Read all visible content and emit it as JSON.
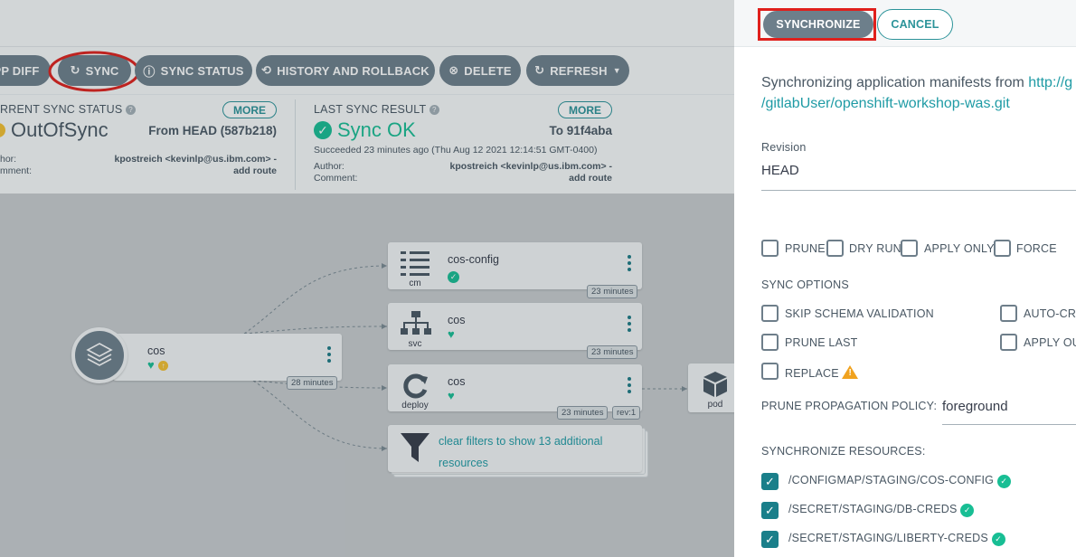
{
  "toolbar": {
    "app_diff": "PP DIFF",
    "sync": "SYNC",
    "sync_status": "SYNC STATUS",
    "history": "HISTORY AND ROLLBACK",
    "delete": "DELETE",
    "refresh": "REFRESH"
  },
  "current_sync": {
    "label": "RRENT SYNC STATUS",
    "more": "MORE",
    "status": "OutOfSync",
    "from": "From HEAD (587b218)",
    "author_label": "hor:",
    "author": "kpostreich <kevinlp@us.ibm.com> -",
    "comment_label": "mment:",
    "comment": "add route"
  },
  "last_sync": {
    "label": "LAST SYNC RESULT",
    "more": "MORE",
    "status": "Sync OK",
    "to": "To 91f4aba",
    "succeeded": "Succeeded 23 minutes ago (Thu Aug 12 2021 12:14:51 GMT-0400)",
    "author_label": "Author:",
    "author": "kpostreich <kevinlp@us.ibm.com> -",
    "comment_label": "Comment:",
    "comment": "add route"
  },
  "graph": {
    "app": {
      "name": "cos",
      "age": "28 minutes"
    },
    "nodes": [
      {
        "name": "cos-config",
        "kind": "cm",
        "age": "23 minutes"
      },
      {
        "name": "cos",
        "kind": "svc",
        "age": "23 minutes"
      },
      {
        "name": "cos",
        "kind": "deploy",
        "age": "23 minutes",
        "rev": "rev:1"
      }
    ],
    "filter_text": "clear filters to show 13 additional resources",
    "pod_kind": "pod"
  },
  "panel": {
    "synchronize": "SYNCHRONIZE",
    "cancel": "CANCEL",
    "msg_prefix": "Synchronizing application manifests from ",
    "msg_link1": "http://g",
    "msg_link2": "/gitlabUser/openshift-workshop-was.git",
    "revision_label": "Revision",
    "revision_value": "HEAD",
    "flags": [
      "PRUNE",
      "DRY RUN",
      "APPLY ONLY",
      "FORCE"
    ],
    "sync_options_label": "SYNC OPTIONS",
    "options_left": [
      "SKIP SCHEMA VALIDATION",
      "PRUNE LAST",
      "REPLACE"
    ],
    "options_right": [
      "AUTO-CRE",
      "APPLY OU"
    ],
    "prune_policy_label": "PRUNE PROPAGATION POLICY:",
    "prune_policy_value": "foreground",
    "resources_label": "SYNCHRONIZE RESOURCES:",
    "resources": [
      "/CONFIGMAP/STAGING/COS-CONFIG",
      "/SECRET/STAGING/DB-CREDS",
      "/SECRET/STAGING/LIBERTY-CREDS"
    ]
  },
  "colors": {
    "accent": "#1f9ba5",
    "highlight": "#e0201c",
    "healthy": "#18be94",
    "warning": "#f0a21f"
  }
}
